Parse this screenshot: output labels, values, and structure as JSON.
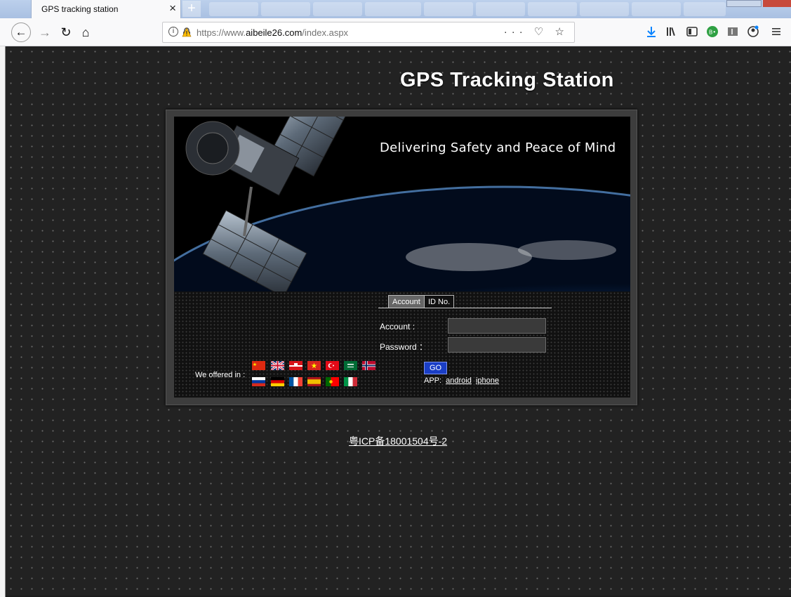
{
  "browser": {
    "tab_title": "GPS tracking station",
    "tab_close": "×",
    "new_tab": "+",
    "url": {
      "prefix": "https://www.",
      "domain": "aibeile26.com",
      "path": "/index.aspx"
    },
    "page_actions": "··· ♡ ☆"
  },
  "page": {
    "site_title": "GPS Tracking Station",
    "tagline": "Delivering Safety and Peace of Mind",
    "tabs": [
      "Account",
      "ID No."
    ],
    "account_label": "Account :",
    "password_label": "Password ：",
    "account_value": "",
    "password_value": "",
    "offered_label": "We offered in :",
    "go_button": "GO",
    "app_label": "APP:",
    "app_links": [
      "android",
      "iphone"
    ],
    "footer_icp": "粤ICP备18001504号-2"
  },
  "colors": {
    "page_background": "#222222",
    "go_button": "#1a3ec6",
    "tabbar": "#a9c0e2"
  }
}
